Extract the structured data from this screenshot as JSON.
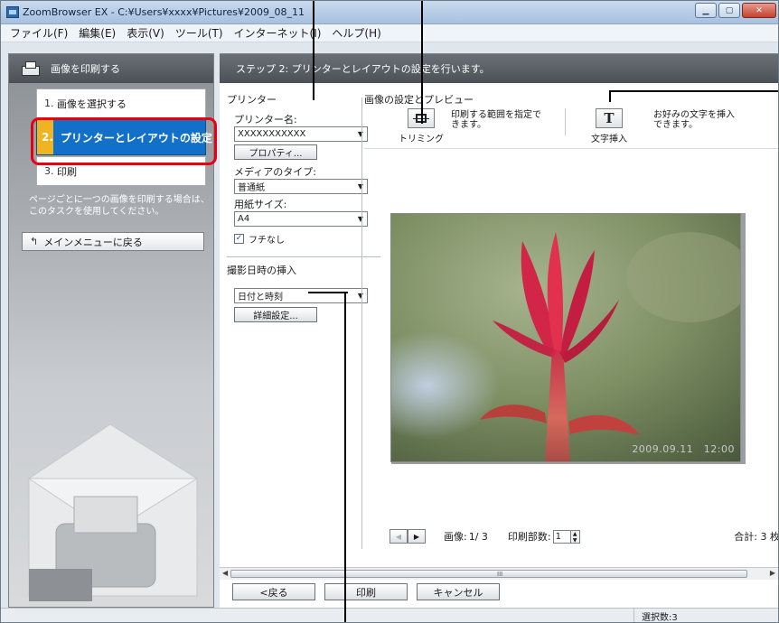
{
  "window": {
    "title": "ZoomBrowser EX - C:¥Users¥xxxx¥Pictures¥2009_08_11"
  },
  "menu": [
    {
      "label": "ファイル(F)"
    },
    {
      "label": "編集(E)"
    },
    {
      "label": "表示(V)"
    },
    {
      "label": "ツール(T)"
    },
    {
      "label": "インターネット(I)"
    },
    {
      "label": "ヘルプ(H)"
    }
  ],
  "left": {
    "header": "画像を印刷する",
    "steps": [
      {
        "num": "1.",
        "label": "画像を選択する"
      },
      {
        "num": "2.",
        "label": "プリンターとレイアウトの設定"
      },
      {
        "num": "3.",
        "label": "印刷"
      }
    ],
    "description": "ページごとに一つの画像を印刷する場合は、このタスクを使用してください。",
    "main_menu_button": "メインメニューに戻る"
  },
  "step_header": "ステップ 2: プリンターとレイアウトの設定を行います。",
  "printer": {
    "section_title": "プリンター",
    "printer_name_label": "プリンター名:",
    "printer_name_value": "XXXXXXXXXXX",
    "properties_button": "プロパティ...",
    "media_type_label": "メディアのタイプ:",
    "media_type_value": "普通紙",
    "paper_size_label": "用紙サイズ:",
    "paper_size_value": "A4",
    "borderless_label": "フチなし",
    "borderless_checked": true
  },
  "date_insert": {
    "section_title": "撮影日時の挿入",
    "value": "日付と時刻",
    "detail_button": "詳細設定..."
  },
  "preview": {
    "title": "画像の設定とプレビュー",
    "trim_caption": "トリミング",
    "trim_desc_line1": "印刷する範囲を指定で",
    "trim_desc_line2": "きます。",
    "text_caption": "文字挿入",
    "text_desc_line1": "お好みの文字を挿入",
    "text_desc_line2": "できます。",
    "photo_date": "2009.09.11　12:00"
  },
  "pager": {
    "image_label": "画像:",
    "image_value": "1/ 3",
    "copies_label": "印刷部数:",
    "copies_value": "1",
    "total": "合計: 3 枚"
  },
  "scroll_grip": "III",
  "buttons": {
    "back": "<戻る",
    "print": "印刷",
    "cancel": "キャンセル"
  },
  "status": {
    "selection": "選択数:3"
  },
  "colors": {
    "active_step": "#1270c8",
    "active_step_num": "#f0b322",
    "highlight_ring": "#e60012"
  }
}
